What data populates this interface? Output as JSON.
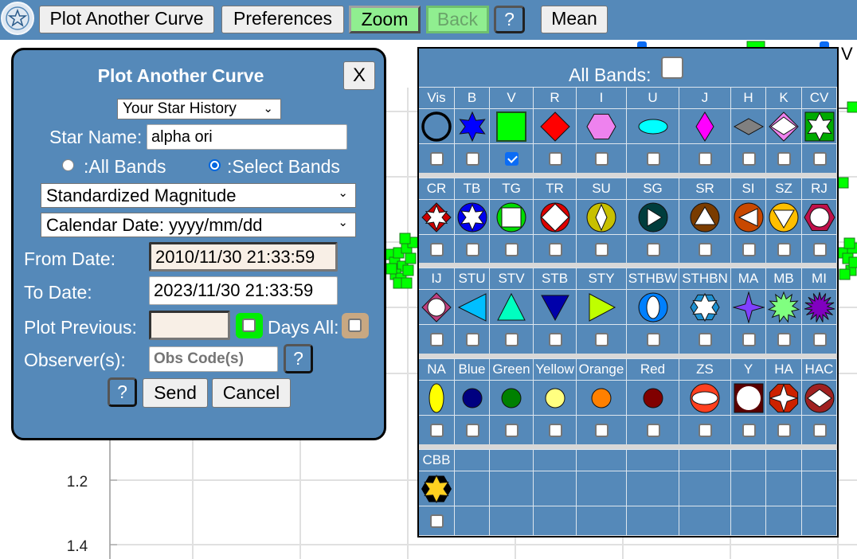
{
  "toolbar": {
    "logo_icon": "aavso-star-logo",
    "buttons": [
      {
        "label": "Plot Another Curve"
      },
      {
        "label": "Preferences"
      },
      {
        "label": "Zoom",
        "state": "active"
      },
      {
        "label": "Back",
        "state": "disabled"
      },
      {
        "label": "?"
      },
      {
        "label": "Mean"
      }
    ]
  },
  "chart": {
    "y_ticks": [
      "1.2",
      "1.4"
    ],
    "legend_visible": "V",
    "series_color": "#00ff00"
  },
  "dialog": {
    "title": "Plot Another Curve",
    "close_label": "X",
    "history_select": "Your Star History",
    "star_name_label": "Star Name:",
    "star_name_value": "alpha ori",
    "radio_all_label": ":All Bands",
    "radio_select_label": ":Select Bands",
    "radio_selected": "select",
    "magnitude_select": "Standardized Magnitude",
    "date_format_select": "Calendar Date: yyyy/mm/dd",
    "from_date_label": "From Date:",
    "from_date_value": "2010/11/30 21:33:59",
    "to_date_label": "To Date:",
    "to_date_value": "2023/11/30 21:33:59",
    "plot_previous_label": "Plot Previous:",
    "plot_previous_value": "",
    "days_all_label": "Days All:",
    "observers_label": "Observer(s):",
    "observers_placeholder": "Obs Code(s)",
    "help_label": "?",
    "send_label": "Send",
    "cancel_label": "Cancel"
  },
  "bands_panel": {
    "all_bands_label": "All Bands:",
    "all_bands_checked": false,
    "groups": [
      [
        {
          "name": "Vis",
          "icon": "open-circle",
          "checked": false
        },
        {
          "name": "B",
          "icon": "blue-star",
          "checked": false
        },
        {
          "name": "V",
          "icon": "green-square",
          "checked": true
        },
        {
          "name": "R",
          "icon": "red-diamond",
          "checked": false
        },
        {
          "name": "I",
          "icon": "violet-hexagon",
          "checked": false
        },
        {
          "name": "U",
          "icon": "cyan-ellipse",
          "checked": false
        },
        {
          "name": "J",
          "icon": "magenta-narrow-diamond",
          "checked": false
        },
        {
          "name": "H",
          "icon": "gray-flat-diamond",
          "checked": false
        },
        {
          "name": "K",
          "icon": "pink-double-diamond",
          "checked": false
        },
        {
          "name": "CV",
          "icon": "green-square-white-star",
          "checked": false
        }
      ],
      [
        {
          "name": "CR",
          "icon": "red-diamond-white-star",
          "checked": false
        },
        {
          "name": "TB",
          "icon": "blue-circle-white-star",
          "checked": false
        },
        {
          "name": "TG",
          "icon": "green-circle-white-square",
          "checked": false
        },
        {
          "name": "TR",
          "icon": "red-circle-white-diamond",
          "checked": false
        },
        {
          "name": "SU",
          "icon": "olive-circle-white-diamond",
          "checked": false
        },
        {
          "name": "SG",
          "icon": "teal-circle-white-play",
          "checked": false
        },
        {
          "name": "SR",
          "icon": "brown-circle-white-triangle-up",
          "checked": false
        },
        {
          "name": "SI",
          "icon": "orange-circle-white-triangle-left",
          "checked": false
        },
        {
          "name": "SZ",
          "icon": "gold-circle-white-triangle-down",
          "checked": false
        },
        {
          "name": "RJ",
          "icon": "crimson-hexagon-white-circle",
          "checked": false
        }
      ],
      [
        {
          "name": "IJ",
          "icon": "plum-diamond-white-circle",
          "checked": false
        },
        {
          "name": "STU",
          "icon": "sky-triangle-left",
          "checked": false
        },
        {
          "name": "STV",
          "icon": "aqua-triangle-up",
          "checked": false
        },
        {
          "name": "STB",
          "icon": "navy-triangle-down",
          "checked": false
        },
        {
          "name": "STY",
          "icon": "lime-triangle-right",
          "checked": false
        },
        {
          "name": "STHBW",
          "icon": "blue-circle-white-oval",
          "checked": false
        },
        {
          "name": "STHBN",
          "icon": "blue-hexagon-white-star",
          "checked": false
        },
        {
          "name": "MA",
          "icon": "purple-four-point-star",
          "checked": false
        },
        {
          "name": "MB",
          "icon": "lightgreen-burst",
          "checked": false
        },
        {
          "name": "MI",
          "icon": "purple-burst",
          "checked": false
        }
      ],
      [
        {
          "name": "NA",
          "icon": "yellow-vertical-ellipse",
          "checked": false
        },
        {
          "name": "Blue",
          "icon": "navy-dot",
          "checked": false
        },
        {
          "name": "Green",
          "icon": "green-dot",
          "checked": false
        },
        {
          "name": "Yellow",
          "icon": "lightyellow-dot",
          "checked": false
        },
        {
          "name": "Orange",
          "icon": "orange-dot",
          "checked": false
        },
        {
          "name": "Red",
          "icon": "maroon-dot",
          "checked": false
        },
        {
          "name": "ZS",
          "icon": "tomato-circle-white-oval",
          "checked": false
        },
        {
          "name": "Y",
          "icon": "darkred-square-white-circle",
          "checked": false
        },
        {
          "name": "HA",
          "icon": "red-octagon-white-star",
          "checked": false
        },
        {
          "name": "HAC",
          "icon": "brown-circle-white-diamond",
          "checked": false
        }
      ],
      [
        {
          "name": "CBB",
          "icon": "black-hexagon-yellow-star",
          "checked": false
        }
      ]
    ]
  }
}
